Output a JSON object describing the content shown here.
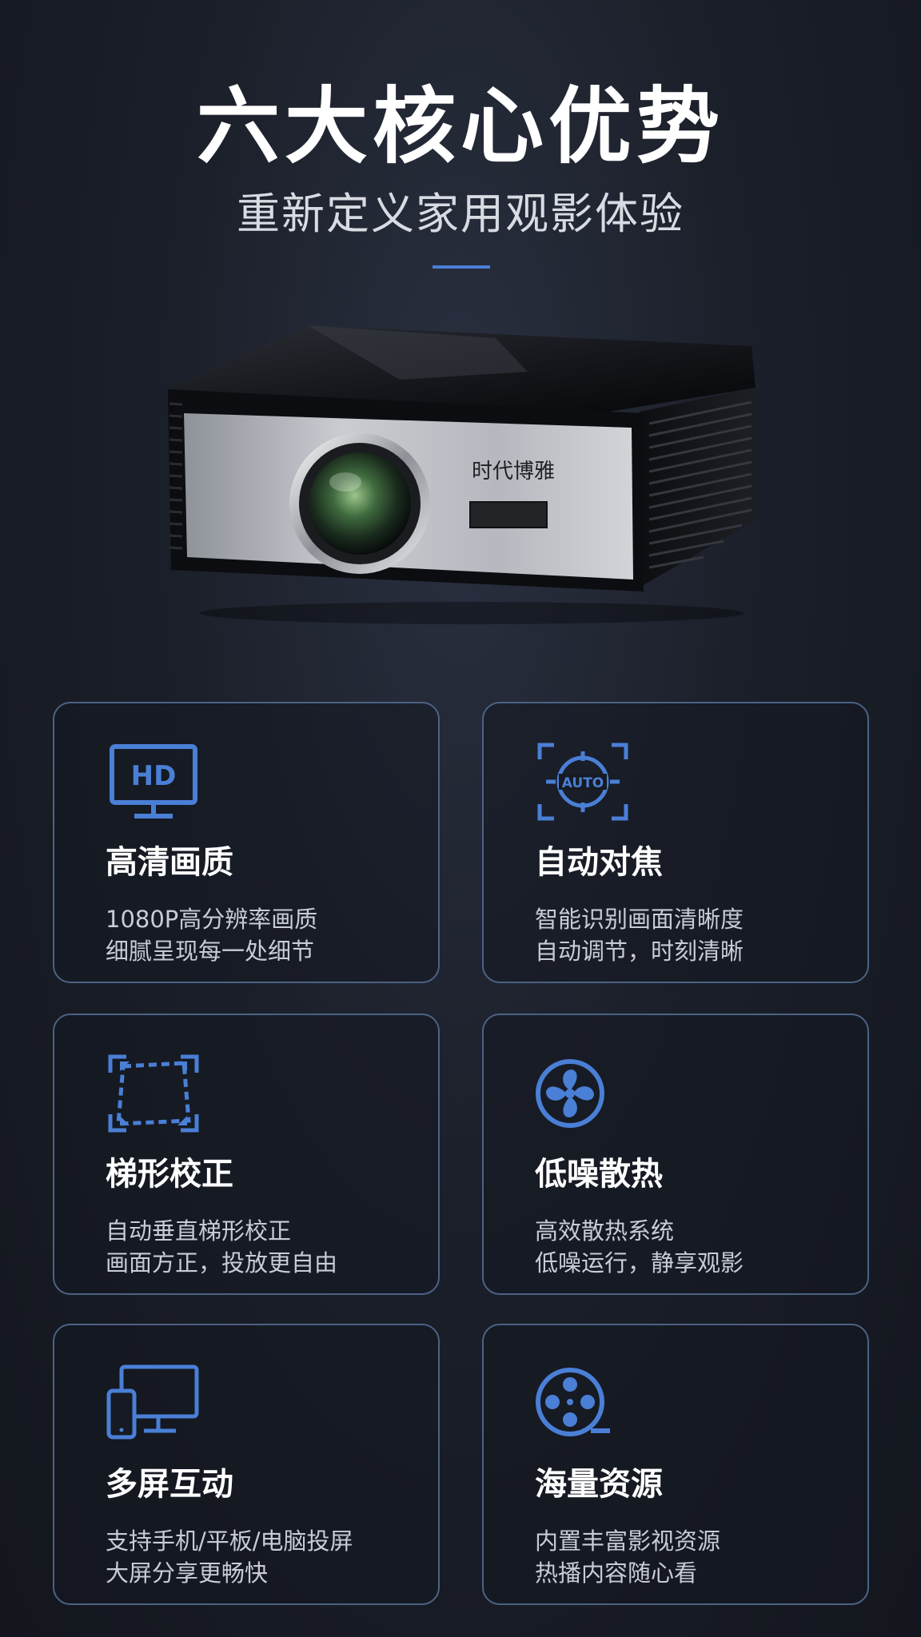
{
  "header": {
    "title": "六大核心优势",
    "subtitle": "重新定义家用观影体验"
  },
  "product": {
    "brand_text": "时代博雅",
    "icon": "projector-image"
  },
  "colors": {
    "accent": "#4a7fd6",
    "card_border": "#4c6286",
    "background": "#1b1f29"
  },
  "features": [
    {
      "icon": "hd-monitor-icon",
      "title": "高清画质",
      "line1": "1080P高分辨率画质",
      "line2": "细腻呈现每一处细节"
    },
    {
      "icon": "auto-focus-icon",
      "icon_text": "AUTO",
      "title": "自动对焦",
      "line1": "智能识别画面清晰度",
      "line2": "自动调节，时刻清晰"
    },
    {
      "icon": "keystone-icon",
      "title": "梯形校正",
      "line1": "自动垂直梯形校正",
      "line2": "画面方正，投放更自由"
    },
    {
      "icon": "fan-icon",
      "title": "低噪散热",
      "line1": "高效散热系统",
      "line2": "低噪运行，静享观影"
    },
    {
      "icon": "multi-screen-icon",
      "title": "多屏互动",
      "line1": "支持手机/平板/电脑投屏",
      "line2": "大屏分享更畅快"
    },
    {
      "icon": "film-reel-icon",
      "title": "海量资源",
      "line1": "内置丰富影视资源",
      "line2": "热播内容随心看"
    }
  ]
}
